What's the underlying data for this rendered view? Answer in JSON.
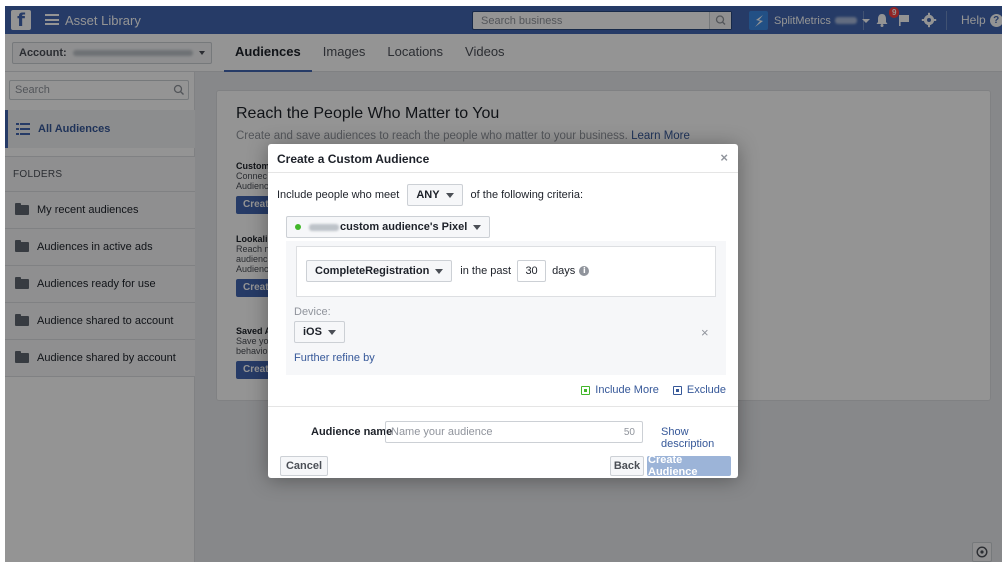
{
  "topbar": {
    "app_title": "Asset Library",
    "search_placeholder": "Search business",
    "account_name": "SplitMetrics",
    "notification_count": "9",
    "help_label": "Help"
  },
  "subnav": {
    "account_label": "Account:",
    "tabs": [
      {
        "label": "Audiences",
        "active": true
      },
      {
        "label": "Images",
        "active": false
      },
      {
        "label": "Locations",
        "active": false
      },
      {
        "label": "Videos",
        "active": false
      }
    ]
  },
  "sidebar": {
    "search_placeholder": "Search",
    "all_audiences": "All Audiences",
    "folders_heading": "FOLDERS",
    "folders": [
      "My recent audiences",
      "Audiences in active ads",
      "Audiences ready for use",
      "Audience shared to account",
      "Audience shared by account"
    ]
  },
  "main": {
    "title": "Reach the People Who Matter to You",
    "subtitle": "Create and save audiences to reach the people who matter to your business.",
    "learn_more": "Learn More",
    "cards": [
      {
        "title": "Custom",
        "lines": [
          "Connec",
          "Audienc"
        ],
        "button": "Creat"
      },
      {
        "title": "Lookali",
        "lines": [
          "Reach n",
          "audienc",
          "Audienc"
        ],
        "button": "Creat"
      },
      {
        "title": "Saved A",
        "lines": [
          "Save yo",
          "behavio"
        ],
        "button": "Creat"
      }
    ]
  },
  "modal": {
    "title": "Create a Custom Audience",
    "close": "×",
    "criteria_prefix": "Include people who meet",
    "criteria_value": "ANY",
    "criteria_suffix": "of the following criteria:",
    "pixel_label": "custom audience's Pixel",
    "event": "CompleteRegistration",
    "in_the_past": "in the past",
    "days_value": "30",
    "days_label": "days",
    "device_label": "Device:",
    "device_value": "iOS",
    "remove": "×",
    "further_refine": "Further refine by",
    "include_more": "Include More",
    "exclude": "Exclude",
    "audience_name_label": "Audience name",
    "audience_name_placeholder": "Name your audience",
    "char_count": "50",
    "show_description": "Show description",
    "cancel": "Cancel",
    "back": "Back",
    "create": "Create Audience"
  },
  "colors": {
    "brand": "#4267b2",
    "link": "#365899",
    "disabled_primary": "#9cb4d8",
    "active_dot": "#42b72a"
  }
}
